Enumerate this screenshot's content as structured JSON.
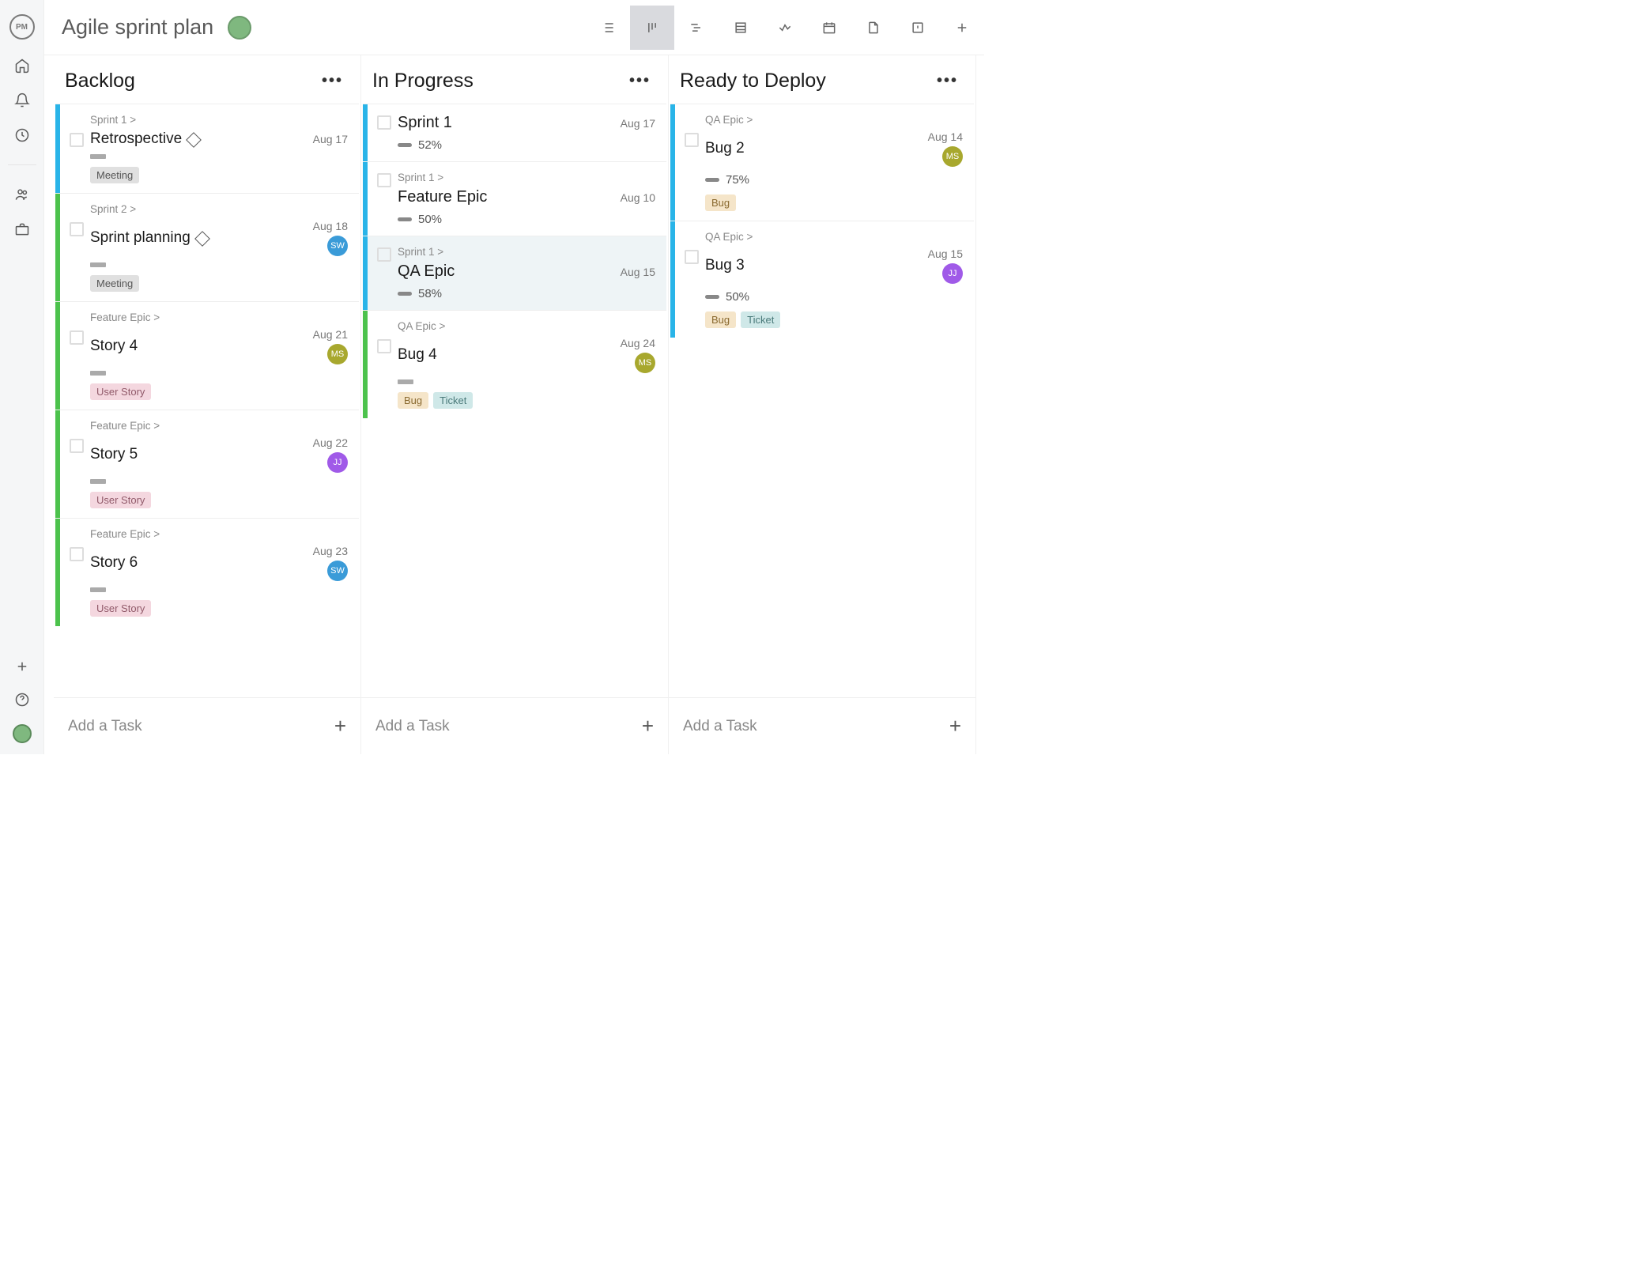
{
  "page_title": "Agile sprint plan",
  "add_task_label": "Add a Task",
  "columns": [
    {
      "title": "Backlog",
      "add": true,
      "cards": [
        {
          "stripe": "blue",
          "bc": "Sprint 1 >",
          "title": "Retrospective",
          "diamond": true,
          "date": "Aug 17",
          "tags": [
            {
              "t": "Meeting",
              "c": "meeting"
            }
          ],
          "bar": true
        },
        {
          "stripe": "green",
          "bc": "Sprint 2 >",
          "title": "Sprint planning",
          "diamond": true,
          "date": "Aug 18",
          "assignee": {
            "i": "SW",
            "c": "sw"
          },
          "tags": [
            {
              "t": "Meeting",
              "c": "meeting"
            }
          ],
          "bar": true
        },
        {
          "stripe": "green",
          "bc": "Feature Epic >",
          "title": "Story 4",
          "date": "Aug 21",
          "assignee": {
            "i": "MS",
            "c": "ms"
          },
          "tags": [
            {
              "t": "User Story",
              "c": "userstory"
            }
          ],
          "bar": true
        },
        {
          "stripe": "green",
          "bc": "Feature Epic >",
          "title": "Story 5",
          "date": "Aug 22",
          "assignee": {
            "i": "JJ",
            "c": "jj"
          },
          "tags": [
            {
              "t": "User Story",
              "c": "userstory"
            }
          ],
          "bar": true
        },
        {
          "stripe": "green",
          "bc": "Feature Epic >",
          "title": "Story 6",
          "date": "Aug 23",
          "assignee": {
            "i": "SW",
            "c": "sw"
          },
          "tags": [
            {
              "t": "User Story",
              "c": "userstory"
            }
          ],
          "bar": true
        }
      ]
    },
    {
      "title": "In Progress",
      "add": true,
      "cards": [
        {
          "stripe": "blue",
          "summary": true,
          "title": "Sprint 1",
          "date": "Aug 17",
          "pct": "52%"
        },
        {
          "stripe": "blue",
          "summary": true,
          "bc": "Sprint 1 >",
          "title": "Feature Epic",
          "date": "Aug 10",
          "pct": "50%"
        },
        {
          "stripe": "blue",
          "summary": true,
          "selected": true,
          "bc": "Sprint 1 >",
          "title": "QA Epic",
          "date": "Aug 15",
          "pct": "58%"
        },
        {
          "stripe": "green",
          "bc": "QA Epic >",
          "title": "Bug 4",
          "date": "Aug 24",
          "assignee": {
            "i": "MS",
            "c": "ms"
          },
          "tags": [
            {
              "t": "Bug",
              "c": "bug"
            },
            {
              "t": "Ticket",
              "c": "ticket"
            }
          ],
          "bar": true
        }
      ]
    },
    {
      "title": "Ready to Deploy",
      "add": true,
      "cards": [
        {
          "stripe": "blue",
          "bc": "QA Epic >",
          "title": "Bug 2",
          "date": "Aug 14",
          "assignee": {
            "i": "MS",
            "c": "ms"
          },
          "pct": "75%",
          "tags": [
            {
              "t": "Bug",
              "c": "bug"
            }
          ]
        },
        {
          "stripe": "blue",
          "bc": "QA Epic >",
          "title": "Bug 3",
          "date": "Aug 15",
          "assignee": {
            "i": "JJ",
            "c": "jj"
          },
          "pct": "50%",
          "tags": [
            {
              "t": "Bug",
              "c": "bug"
            },
            {
              "t": "Ticket",
              "c": "ticket"
            }
          ]
        }
      ]
    }
  ]
}
